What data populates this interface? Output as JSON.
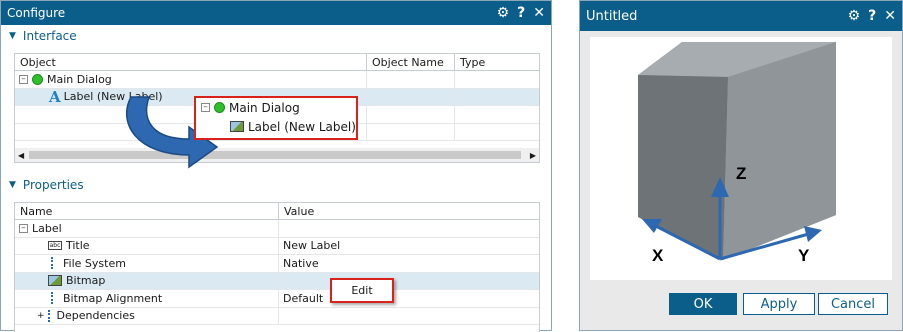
{
  "configure": {
    "title": "Configure",
    "icons": [
      "gear-icon",
      "help-icon",
      "close-icon"
    ],
    "interface_label": "Interface",
    "columns": [
      "Object",
      "Object Name",
      "Type"
    ],
    "tree": [
      {
        "label": "Main Dialog"
      },
      {
        "label": "Label (New Label)"
      }
    ],
    "callout": {
      "root": "Main Dialog",
      "child": "Label (New Label)"
    },
    "properties_label": "Properties",
    "prop_columns": [
      "Name",
      "Value"
    ],
    "props": [
      {
        "name": "Label",
        "value": ""
      },
      {
        "name": "Title",
        "value": "New Label"
      },
      {
        "name": "File System",
        "value": "Native"
      },
      {
        "name": "Bitmap",
        "value": ""
      },
      {
        "name": "Bitmap Alignment",
        "value": "Default"
      },
      {
        "name": "Dependencies",
        "value": ""
      }
    ],
    "edit_button": "Edit"
  },
  "untitled": {
    "title": "Untitled",
    "icons": [
      "gear-icon",
      "help-icon",
      "close-icon"
    ],
    "axes": {
      "x": "X",
      "y": "Y",
      "z": "Z"
    },
    "buttons": {
      "ok": "OK",
      "apply": "Apply",
      "cancel": "Cancel"
    }
  },
  "colors": {
    "accent": "#0c5e8a",
    "highlight": "#d9221c",
    "arrow": "#2d68b1"
  }
}
